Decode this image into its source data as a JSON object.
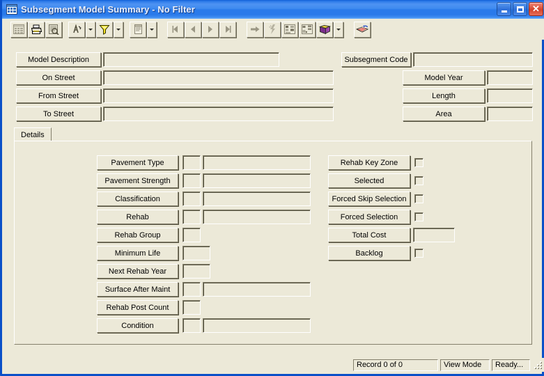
{
  "window": {
    "title": "Subsegment Model Summary - No Filter",
    "icon": "grid-icon",
    "controls": {
      "minimize": "_",
      "maximize": "□",
      "close": "✕"
    },
    "colors": {
      "titlebar": "#2a7aea",
      "face": "#ece9d8",
      "border": "#0a50c8",
      "close": "#d4432a"
    }
  },
  "toolbar": {
    "buttons": [
      {
        "name": "datasheet-icon",
        "title": "Datasheet"
      },
      {
        "name": "print-icon",
        "title": "Print"
      },
      {
        "name": "print-preview-icon",
        "title": "Print Preview"
      },
      {
        "name": "find-icon",
        "title": "Find"
      },
      {
        "name": "find-dropdown-icon",
        "title": "Find Options"
      },
      {
        "name": "filter-icon",
        "title": "Filter"
      },
      {
        "name": "filter-dropdown-icon",
        "title": "Filter Options"
      },
      {
        "name": "report-icon",
        "title": "Report"
      },
      {
        "name": "report-dropdown-icon",
        "title": "Report Options"
      },
      {
        "name": "first-record-icon",
        "title": "First Record"
      },
      {
        "name": "previous-record-icon",
        "title": "Previous Record"
      },
      {
        "name": "next-record-icon",
        "title": "Next Record"
      },
      {
        "name": "last-record-icon",
        "title": "Last Record"
      },
      {
        "name": "goto-icon",
        "title": "Go To"
      },
      {
        "name": "lightning-icon",
        "title": "Execute"
      },
      {
        "name": "hierarchy-icon",
        "title": "Hierarchy"
      },
      {
        "name": "structure-icon",
        "title": "Structure"
      },
      {
        "name": "book-icon",
        "title": "Reference"
      },
      {
        "name": "book-dropdown-icon",
        "title": "Reference Options"
      },
      {
        "name": "export-icon",
        "title": "Export"
      }
    ]
  },
  "header": {
    "left_fields": [
      {
        "label": "Model Description",
        "value": ""
      },
      {
        "label": "On Street",
        "value": ""
      },
      {
        "label": "From Street",
        "value": ""
      },
      {
        "label": "To Street",
        "value": ""
      }
    ],
    "subsegment_code": {
      "label": "Subsegment Code",
      "value": ""
    },
    "right_fields": [
      {
        "label": "Model Year",
        "value": ""
      },
      {
        "label": "Length",
        "value": ""
      },
      {
        "label": "Area",
        "value": ""
      }
    ]
  },
  "tabs": [
    {
      "label": "Details",
      "selected": true
    }
  ],
  "details": {
    "left_rows": [
      {
        "label": "Pavement Type",
        "code": "",
        "desc": "",
        "has_desc": true,
        "small_w": 26
      },
      {
        "label": "Pavement Strength",
        "code": "",
        "desc": "",
        "has_desc": true,
        "small_w": 26
      },
      {
        "label": "Classification",
        "code": "",
        "desc": "",
        "has_desc": true,
        "small_w": 26
      },
      {
        "label": "Rehab",
        "code": "",
        "desc": "",
        "has_desc": true,
        "small_w": 26
      },
      {
        "label": "Rehab Group",
        "code": "",
        "desc": null,
        "has_desc": false,
        "small_w": 26
      },
      {
        "label": "Minimum Life",
        "code": "",
        "desc": null,
        "has_desc": false,
        "small_w": 40
      },
      {
        "label": "Next Rehab Year",
        "code": "",
        "desc": null,
        "has_desc": false,
        "small_w": 40
      },
      {
        "label": "Surface After Maint",
        "code": "",
        "desc": "",
        "has_desc": true,
        "small_w": 26
      },
      {
        "label": "Rehab Post Count",
        "code": "",
        "desc": null,
        "has_desc": false,
        "small_w": 26
      },
      {
        "label": "Condition",
        "code": "",
        "desc": "",
        "has_desc": true,
        "small_w": 26
      }
    ],
    "right_rows": [
      {
        "label": "Rehab Key Zone",
        "type": "checkbox",
        "checked": false
      },
      {
        "label": "Selected",
        "type": "checkbox",
        "checked": false
      },
      {
        "label": "Forced Skip Selection",
        "type": "checkbox",
        "checked": false
      },
      {
        "label": "Forced Selection",
        "type": "checkbox",
        "checked": false
      },
      {
        "label": "Total Cost",
        "type": "text",
        "value": ""
      },
      {
        "label": "Backlog",
        "type": "checkbox",
        "checked": false
      }
    ]
  },
  "status": {
    "record": "Record 0 of 0",
    "mode": "View Mode",
    "state": "Ready..."
  }
}
